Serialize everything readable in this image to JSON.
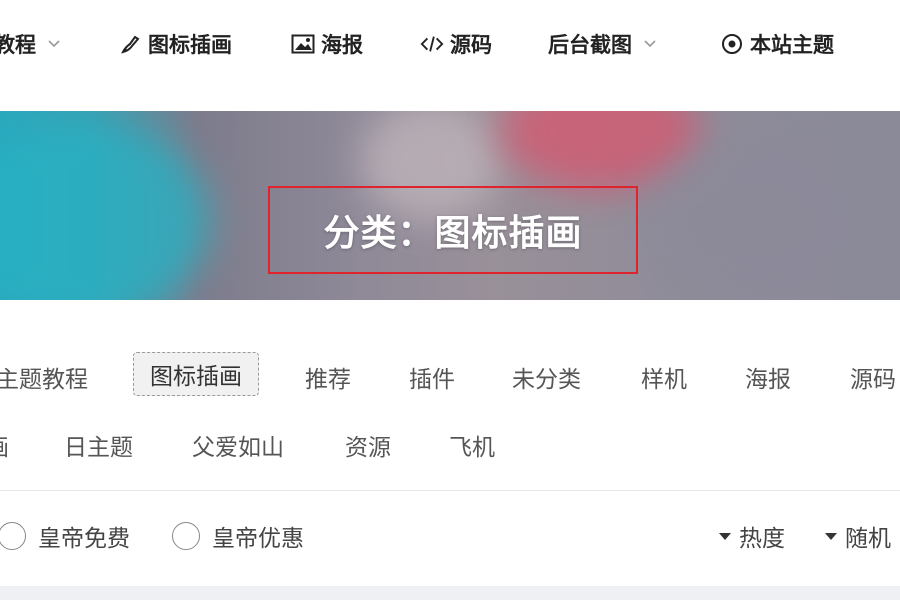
{
  "nav": {
    "items": [
      {
        "label": "教程",
        "icon": "none",
        "dropdown": true
      },
      {
        "label": "图标插画",
        "icon": "brush-icon",
        "dropdown": false
      },
      {
        "label": "海报",
        "icon": "image-icon",
        "dropdown": false
      },
      {
        "label": "源码",
        "icon": "code-icon",
        "dropdown": false
      },
      {
        "label": "后台截图",
        "icon": "none",
        "dropdown": true
      },
      {
        "label": "本站主题",
        "icon": "target-icon",
        "dropdown": false
      }
    ]
  },
  "banner": {
    "title": "分类：图标插画",
    "highlight_color": "#e0242d"
  },
  "categories": {
    "row1": [
      "主题教程",
      "图标插画",
      "推荐",
      "插件",
      "未分类",
      "样机",
      "海报",
      "源码"
    ],
    "row2": [
      "画",
      "日主题",
      "父爱如山",
      "资源",
      "飞机"
    ],
    "active": "图标插画"
  },
  "filters": {
    "radios": [
      "皇帝免费",
      "皇帝优惠"
    ],
    "sorts": [
      "热度",
      "随机"
    ]
  }
}
